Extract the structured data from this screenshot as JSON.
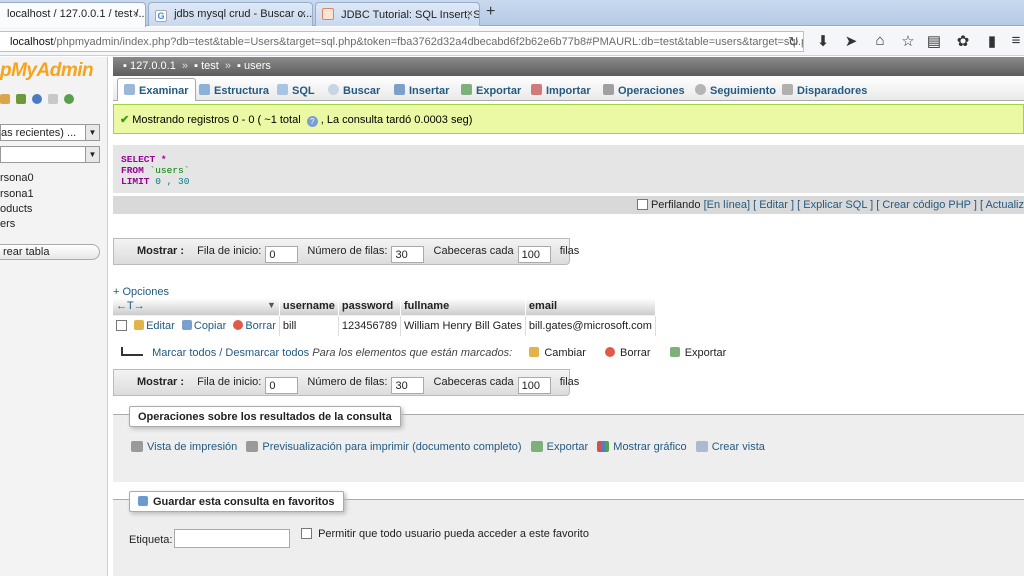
{
  "browser": {
    "tabs": [
      {
        "label": "localhost / 127.0.0.1 / test /...",
        "close": "×"
      },
      {
        "label": "jdbs mysql crud - Buscar c...",
        "close": "×"
      },
      {
        "label": "JDBC Tutorial: SQL Insert, S...",
        "close": "×"
      }
    ],
    "new_tab": "+",
    "url_host": "localhost",
    "url_path": "/phpmyadmin/index.php?db=test&table=Users&target=sql.php&token=fba3762d32a4dbecabd6f2b62e6b77b8#PMAURL:db=test&table=users&target=sql.php&token=fb",
    "toolbar_icons": [
      "download-icon",
      "send-icon",
      "home-icon",
      "star-icon",
      "reading-list-icon",
      "extension-icon",
      "battery-icon",
      "menu-icon"
    ]
  },
  "leftnav": {
    "logo": "pMyAdmin",
    "recent_select": "as recientes) ...",
    "db_select": "",
    "tree": [
      "rsona0",
      "rsona1",
      "oducts",
      "ers"
    ],
    "create_table": "rear tabla"
  },
  "breadcrumb": {
    "server": "127.0.0.1",
    "db": "test",
    "table": "users",
    "sep": "»"
  },
  "tabs": [
    "Examinar",
    "Estructura",
    "SQL",
    "Buscar",
    "Insertar",
    "Exportar",
    "Importar",
    "Operaciones",
    "Seguimiento",
    "Disparadores"
  ],
  "success": {
    "text": "Mostrando registros 0 - 0 ( ~1 total",
    "help": "?",
    "text2": ", La consulta tardó 0.0003 seg)"
  },
  "sql": {
    "select": "SELECT",
    "star": " *",
    "from": "FROM",
    "table": " `users`",
    "limit": "LIMIT",
    "limit_vals": " 0 , 30"
  },
  "sql_options": {
    "profiling": "Perfilando",
    "inline": "[En línea]",
    "edit": "[ Editar ]",
    "explain": "[ Explicar SQL ]",
    "php": "[ Crear código PHP ]",
    "refresh": "[ Actualiz"
  },
  "navbar": {
    "show": "Mostrar :",
    "start_label": "Fila de inicio:",
    "start_value": "0",
    "rows_label": "Número de filas:",
    "rows_value": "30",
    "headers_label": "Cabeceras cada",
    "headers_value": "100",
    "rows_suffix": "filas"
  },
  "options_link": "+ Opciones",
  "table": {
    "columns": [
      "username",
      "password",
      "fullname",
      "email"
    ],
    "actions": [
      "Editar",
      "Copiar",
      "Borrar"
    ],
    "rows": [
      {
        "username": "bill",
        "password": "123456789",
        "fullname": "William Henry Bill Gates",
        "email": "bill.gates@microsoft.com"
      }
    ]
  },
  "bulk": {
    "check_all": "Marcar todos / Desmarcar todos",
    "with_selected": "Para los elementos que están marcados:",
    "change": "Cambiar",
    "delete": "Borrar",
    "export": "Exportar"
  },
  "query_ops": {
    "legend": "Operaciones sobre los resultados de la consulta",
    "print": "Vista de impresión",
    "print_full": "Previsualización para imprimir (documento completo)",
    "export": "Exportar",
    "chart": "Mostrar gráfico",
    "view": "Crear vista"
  },
  "bookmark": {
    "legend": "Guardar esta consulta en favoritos",
    "label": "Etiqueta:",
    "public": "Permitir que todo usuario pueda acceder a este favorito"
  },
  "colors": {
    "link": "#235a81",
    "success_bg": "#ebf8a4",
    "logo": "#f7a31c"
  }
}
